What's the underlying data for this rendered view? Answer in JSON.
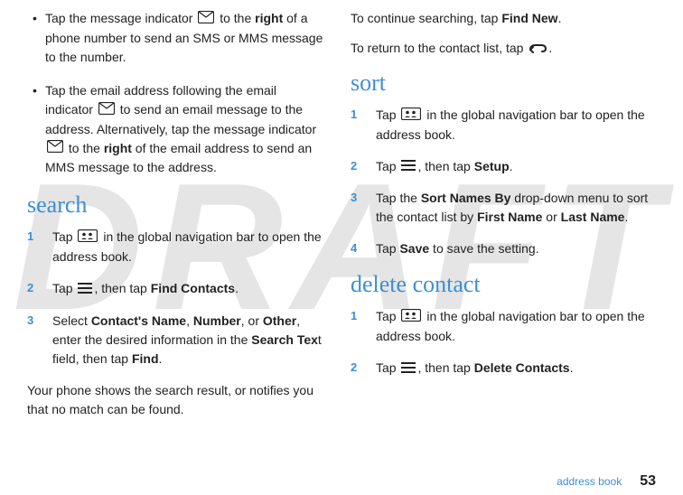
{
  "watermark": "DRAFT",
  "leftColumn": {
    "bullets": [
      {
        "parts": [
          {
            "t": "Tap the message indicator "
          },
          {
            "icon": "envelope-icon"
          },
          {
            "t": " to the "
          },
          {
            "bold": "right"
          },
          {
            "t": " of a phone number to send an SMS or MMS message to the number."
          }
        ]
      },
      {
        "parts": [
          {
            "t": "Tap the email address following the email indicator "
          },
          {
            "icon": "envelope-icon"
          },
          {
            "t": " to send an email message to the address. Alternatively, tap the message indicator "
          },
          {
            "icon": "envelope-icon"
          },
          {
            "t": " to the "
          },
          {
            "bold": "right"
          },
          {
            "t": " of the email address to send an MMS message to the address."
          }
        ]
      }
    ],
    "heading": "search",
    "steps": [
      {
        "num": "1",
        "parts": [
          {
            "t": "Tap "
          },
          {
            "icon": "contacts-icon"
          },
          {
            "t": " in the global navigation bar to open the address book."
          }
        ]
      },
      {
        "num": "2",
        "parts": [
          {
            "t": "Tap "
          },
          {
            "icon": "menu-icon"
          },
          {
            "t": ", then tap "
          },
          {
            "bold": "Find Contacts"
          },
          {
            "t": "."
          }
        ]
      },
      {
        "num": "3",
        "parts": [
          {
            "t": "Select "
          },
          {
            "bold": "Contact's Name"
          },
          {
            "t": ", "
          },
          {
            "bold": "Number"
          },
          {
            "t": ", or "
          },
          {
            "bold": "Other"
          },
          {
            "t": ", enter the desired information in the "
          },
          {
            "bold": "Search Tex"
          },
          {
            "t": "t field, then tap "
          },
          {
            "bold": "Find"
          },
          {
            "t": "."
          }
        ]
      }
    ],
    "footer": "Your phone shows the search result, or notifies you that no match can be found."
  },
  "rightColumn": {
    "topParagraphs": [
      {
        "parts": [
          {
            "t": "To continue searching, tap "
          },
          {
            "bold": "Find New"
          },
          {
            "t": "."
          }
        ]
      },
      {
        "parts": [
          {
            "t": "To return to the contact list, tap "
          },
          {
            "icon": "back-icon"
          },
          {
            "t": "."
          }
        ]
      }
    ],
    "sections": [
      {
        "heading": "sort",
        "steps": [
          {
            "num": "1",
            "parts": [
              {
                "t": "Tap "
              },
              {
                "icon": "contacts-icon"
              },
              {
                "t": " in the global navigation bar to open the address book."
              }
            ]
          },
          {
            "num": "2",
            "parts": [
              {
                "t": "Tap "
              },
              {
                "icon": "menu-icon"
              },
              {
                "t": ", then tap "
              },
              {
                "bold": "Setup"
              },
              {
                "t": "."
              }
            ]
          },
          {
            "num": "3",
            "parts": [
              {
                "t": "Tap the "
              },
              {
                "bold": "Sort Names By"
              },
              {
                "t": " drop-down menu to sort the contact list by "
              },
              {
                "bold": "First Name"
              },
              {
                "t": " or "
              },
              {
                "bold": "Last Name"
              },
              {
                "t": "."
              }
            ]
          },
          {
            "num": "4",
            "parts": [
              {
                "t": "Tap "
              },
              {
                "bold": "Save"
              },
              {
                "t": " to save the setting."
              }
            ]
          }
        ]
      },
      {
        "heading": "delete contact",
        "steps": [
          {
            "num": "1",
            "parts": [
              {
                "t": "Tap "
              },
              {
                "icon": "contacts-icon"
              },
              {
                "t": " in the global navigation bar to open the address book."
              }
            ]
          },
          {
            "num": "2",
            "parts": [
              {
                "t": "Tap "
              },
              {
                "icon": "menu-icon"
              },
              {
                "t": ", then tap "
              },
              {
                "bold": "Delete Contacts"
              },
              {
                "t": "."
              }
            ]
          }
        ]
      }
    ]
  },
  "pageFooter": {
    "label": "address book",
    "page": "53"
  },
  "icons": {
    "envelope-icon": "envelope",
    "contacts-icon": "contacts",
    "menu-icon": "menu",
    "back-icon": "back"
  }
}
